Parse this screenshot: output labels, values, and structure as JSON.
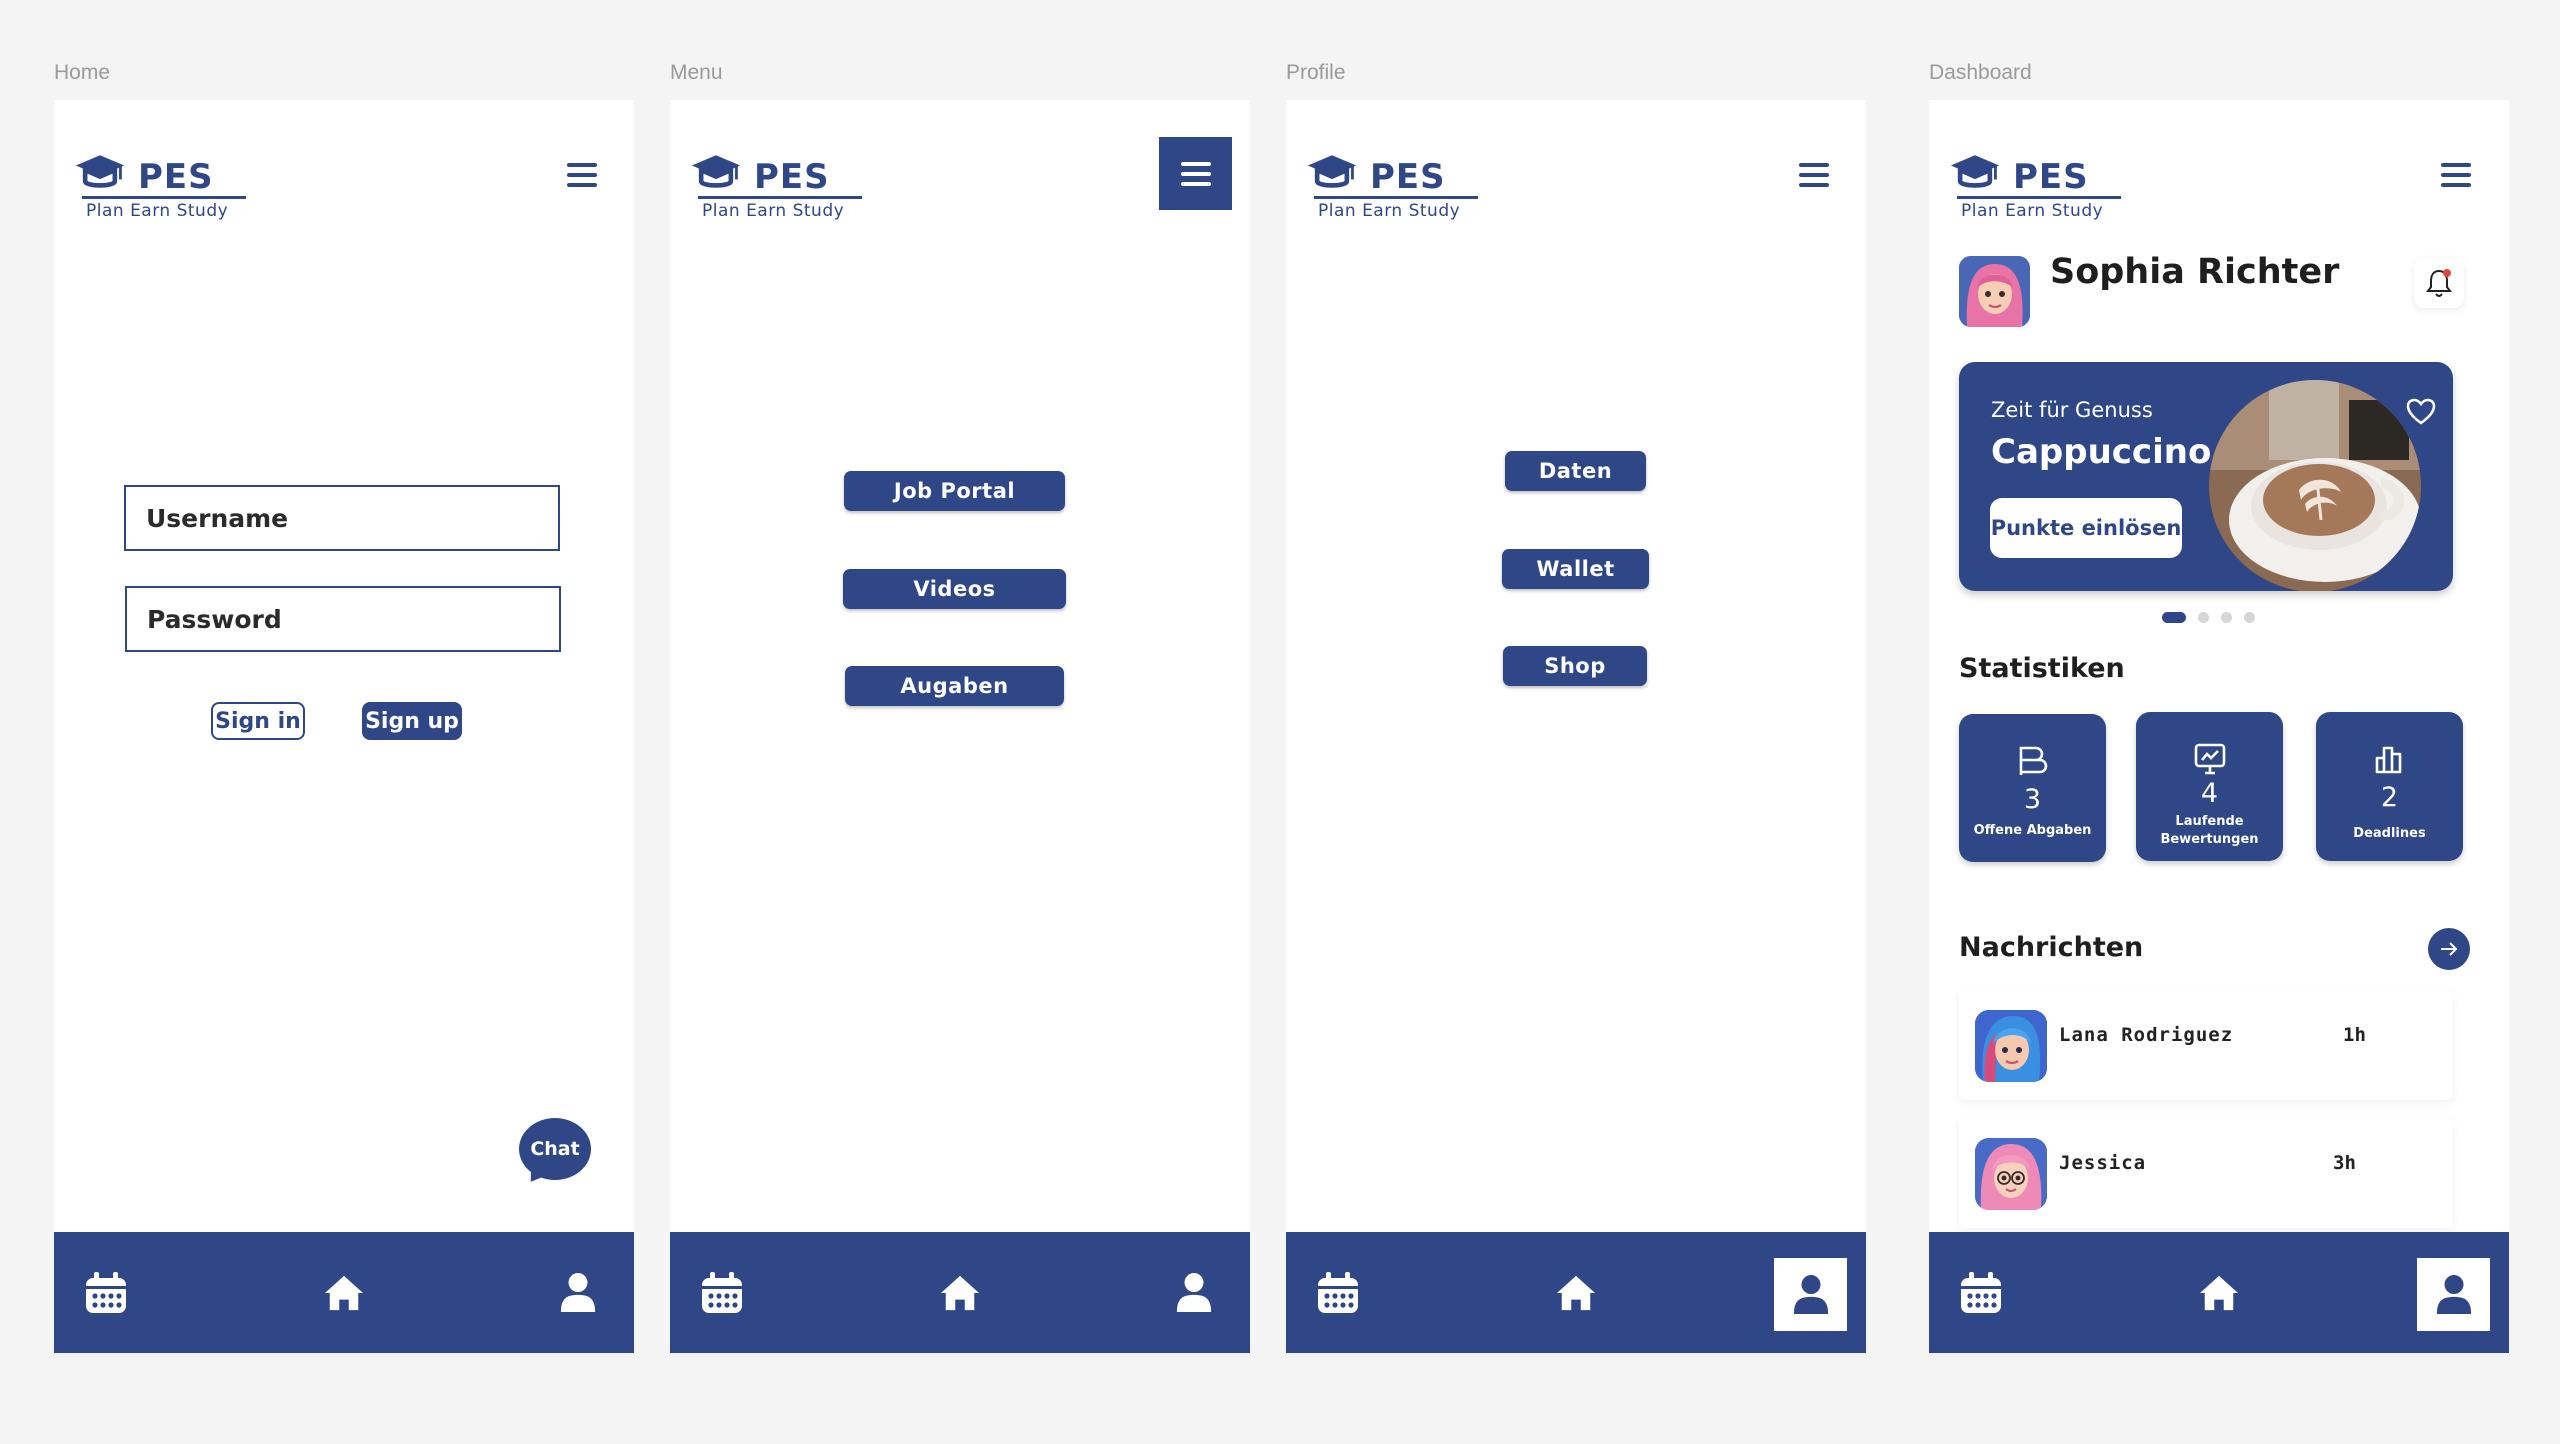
{
  "frames": {
    "home": {
      "label": "Home"
    },
    "menu": {
      "label": "Menu"
    },
    "profile": {
      "label": "Profile"
    },
    "dashboard": {
      "label": "Dashboard"
    }
  },
  "brand": {
    "name": "PES",
    "tagline": "Plan Earn Study",
    "color": "#2f4786"
  },
  "login": {
    "username_placeholder": "Username",
    "password_placeholder": "Password",
    "sign_in": "Sign in",
    "sign_up": "Sign up",
    "chat": "Chat"
  },
  "menu": {
    "items": [
      "Job Portal",
      "Videos",
      "Augaben"
    ]
  },
  "profile": {
    "items": [
      "Daten",
      "Wallet",
      "Shop"
    ]
  },
  "dashboard": {
    "user": "Sophia Richter",
    "promo": {
      "subtitle": "Zeit für Genuss",
      "title": "Cappuccino",
      "cta": "Punkte einlösen",
      "slides": 4,
      "active_slide": 1
    },
    "stats_title": "Statistiken",
    "stats": [
      {
        "value": "3",
        "label": "Offene Abgaben",
        "icon": "document-icon"
      },
      {
        "value": "4",
        "label": "Laufende Bewertungen",
        "icon": "monitor-chart-icon"
      },
      {
        "value": "2",
        "label": "Deadlines",
        "icon": "bar-chart-icon"
      }
    ],
    "messages_title": "Nachrichten",
    "messages": [
      {
        "name": "Lana Rodriguez",
        "time": "1h"
      },
      {
        "name": "Jessica",
        "time": "3h"
      }
    ]
  },
  "nav": {
    "icons": [
      "calendar-icon",
      "home-icon",
      "user-icon"
    ]
  }
}
